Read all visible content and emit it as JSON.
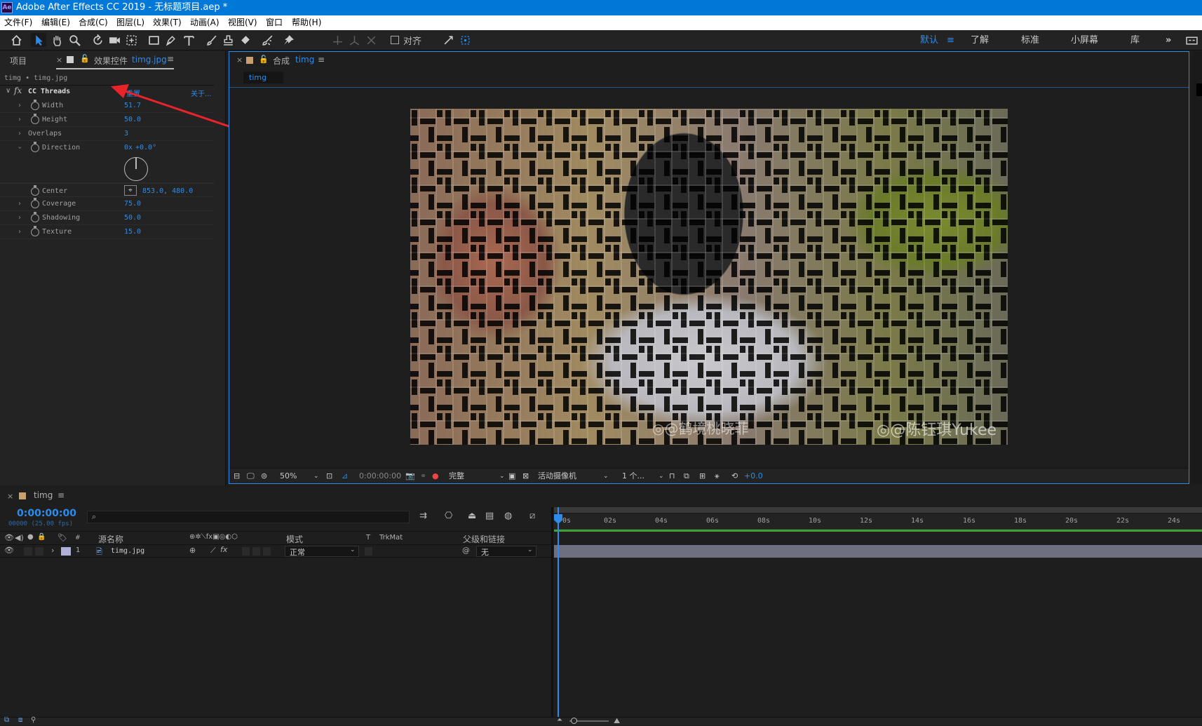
{
  "app": {
    "title": "Adobe After Effects CC 2019 - 无标题项目.aep *",
    "logo": "Ae"
  },
  "menu": [
    "文件(F)",
    "编辑(E)",
    "合成(C)",
    "图层(L)",
    "效果(T)",
    "动画(A)",
    "视图(V)",
    "窗口",
    "帮助(H)"
  ],
  "toolbar": {
    "align_label": "对齐",
    "workspaces": [
      "默认",
      "了解",
      "标准",
      "小屏幕",
      "库"
    ],
    "active_workspace": "默认",
    "more": "»"
  },
  "left_panel": {
    "tab_project": "项目",
    "tab_effects": "效果控件",
    "tab_effects_target": "timg.jpg",
    "breadcrumb": "timg • timg.jpg",
    "effect": {
      "fx": "fx",
      "name": "CC Threads",
      "reset": "重置",
      "about": "关于...",
      "properties": [
        {
          "name": "Width",
          "value": "51.7"
        },
        {
          "name": "Height",
          "value": "50.0"
        },
        {
          "name": "Overlaps",
          "value": "3"
        },
        {
          "name": "Direction",
          "value_prefix": "0x",
          "value": "+0.0°"
        },
        {
          "name": "Center",
          "value": "853.0, 480.0"
        },
        {
          "name": "Coverage",
          "value": "75.0"
        },
        {
          "name": "Shadowing",
          "value": "50.0"
        },
        {
          "name": "Texture",
          "value": "15.0"
        }
      ]
    }
  },
  "composition": {
    "tab_label": "合成",
    "comp_name": "timg",
    "breadcrumb": "timg",
    "watermark_1": "◎@鹤境桃晓菲",
    "watermark_2": "◎@陈钰琪Yukee",
    "viewer": {
      "zoom": "50%",
      "timecode": "0:00:00:00",
      "resolution": "完整",
      "camera": "活动摄像机",
      "views": "1 个...",
      "exposure": "+0.0"
    }
  },
  "timeline": {
    "tab": "timg",
    "timecode": "0:00:00:00",
    "frame_info": "00000 (25.00 fps)",
    "search_placeholder": "",
    "columns": {
      "num": "#",
      "source": "源名称",
      "mode": "模式",
      "t": "T",
      "trkmat": "TrkMat",
      "parent": "父级和链接"
    },
    "layers": [
      {
        "num": "1",
        "name": "timg.jpg",
        "mode": "正常",
        "parent": "无"
      }
    ],
    "ruler": [
      "0s",
      "02s",
      "04s",
      "06s",
      "08s",
      "10s",
      "12s",
      "14s",
      "16s",
      "18s",
      "20s",
      "22s",
      "24s"
    ]
  },
  "colors": {
    "accent": "#2d8ceb",
    "titlebar": "#0078d7",
    "panel": "#232323",
    "layer_bar": "#6e6e80",
    "work_area": "#3fa132"
  }
}
